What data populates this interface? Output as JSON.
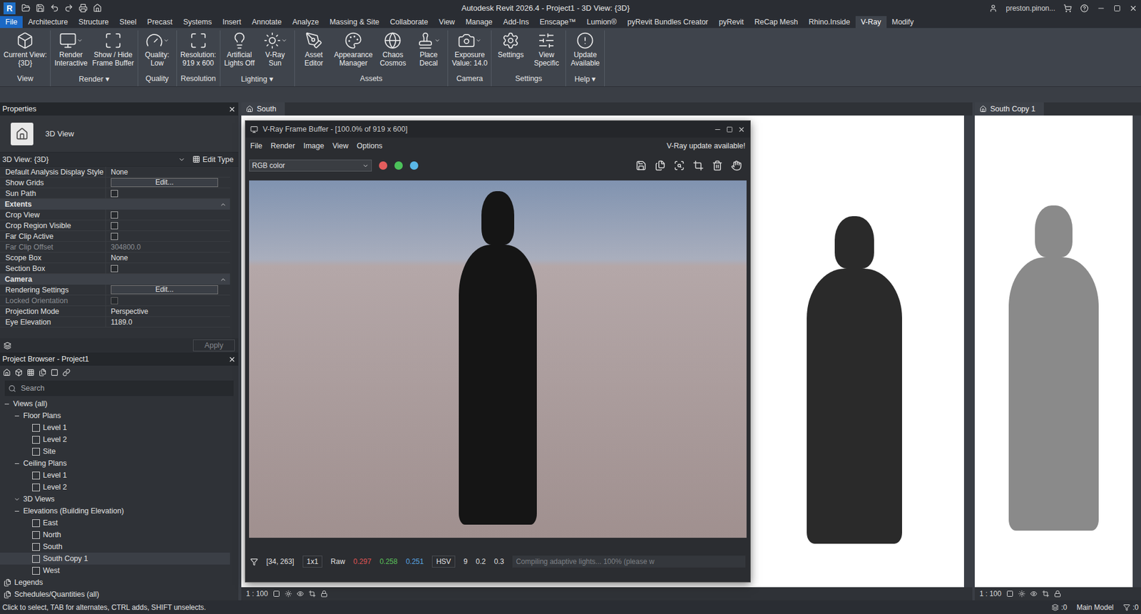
{
  "window": {
    "logo": "R",
    "title": "Autodesk Revit 2026.4 - Project1 - 3D View: {3D}",
    "user": "preston.pinon..."
  },
  "ribbon_tabs": [
    {
      "label": "File",
      "kind": "file",
      "selected": false
    },
    {
      "label": "Architecture",
      "kind": "tab",
      "selected": false
    },
    {
      "label": "Structure",
      "kind": "tab",
      "selected": false
    },
    {
      "label": "Steel",
      "kind": "tab",
      "selected": false
    },
    {
      "label": "Precast",
      "kind": "tab",
      "selected": false
    },
    {
      "label": "Systems",
      "kind": "tab",
      "selected": false
    },
    {
      "label": "Insert",
      "kind": "tab",
      "selected": false
    },
    {
      "label": "Annotate",
      "kind": "tab",
      "selected": false
    },
    {
      "label": "Analyze",
      "kind": "tab",
      "selected": false
    },
    {
      "label": "Massing & Site",
      "kind": "tab",
      "selected": false
    },
    {
      "label": "Collaborate",
      "kind": "tab",
      "selected": false
    },
    {
      "label": "View",
      "kind": "tab",
      "selected": false
    },
    {
      "label": "Manage",
      "kind": "tab",
      "selected": false
    },
    {
      "label": "Add-Ins",
      "kind": "tab",
      "selected": false
    },
    {
      "label": "Enscape™",
      "kind": "tab",
      "selected": false
    },
    {
      "label": "Lumion®",
      "kind": "tab",
      "selected": false
    },
    {
      "label": "pyRevit Bundles Creator",
      "kind": "tab",
      "selected": false
    },
    {
      "label": "pyRevit",
      "kind": "tab",
      "selected": false
    },
    {
      "label": "ReCap Mesh",
      "kind": "tab",
      "selected": false
    },
    {
      "label": "Rhino.Inside",
      "kind": "tab",
      "selected": false
    },
    {
      "label": "V-Ray",
      "kind": "tab",
      "selected": true
    },
    {
      "label": "Modify",
      "kind": "tab",
      "selected": false
    }
  ],
  "ribbon_groups": [
    {
      "label": "View",
      "buttons": [
        {
          "lines": [
            "Current View:",
            "{3D}"
          ],
          "dropdown": false
        }
      ]
    },
    {
      "label": "Render ▾",
      "buttons": [
        {
          "lines": [
            "Render",
            "Interactive"
          ],
          "dropdown": true
        },
        {
          "lines": [
            "Show / Hide",
            "Frame Buffer"
          ],
          "dropdown": false
        }
      ]
    },
    {
      "label": "Quality",
      "buttons": [
        {
          "lines": [
            "Quality:",
            "Low"
          ],
          "dropdown": true
        }
      ]
    },
    {
      "label": "Resolution",
      "buttons": [
        {
          "lines": [
            "Resolution:",
            "919 x 600"
          ],
          "dropdown": false
        }
      ]
    },
    {
      "label": "Lighting ▾",
      "buttons": [
        {
          "lines": [
            "Artificial",
            "Lights Off"
          ],
          "dropdown": false
        },
        {
          "lines": [
            "V-Ray",
            "Sun"
          ],
          "dropdown": true
        }
      ]
    },
    {
      "label": "Assets",
      "buttons": [
        {
          "lines": [
            "Asset",
            "Editor"
          ],
          "dropdown": false
        },
        {
          "lines": [
            "Appearance",
            "Manager"
          ],
          "dropdown": false
        },
        {
          "lines": [
            "Chaos",
            "Cosmos"
          ],
          "dropdown": false
        },
        {
          "lines": [
            "Place",
            "Decal"
          ],
          "dropdown": true
        }
      ]
    },
    {
      "label": "Camera",
      "buttons": [
        {
          "lines": [
            "Exposure",
            "Value: 14.0"
          ],
          "dropdown": true
        }
      ]
    },
    {
      "label": "Settings",
      "buttons": [
        {
          "lines": [
            "Settings"
          ],
          "dropdown": false
        },
        {
          "lines": [
            "View",
            "Specific"
          ],
          "dropdown": false
        }
      ]
    },
    {
      "label": "Help ▾",
      "buttons": [
        {
          "lines": [
            "Update",
            "Available"
          ],
          "dropdown": false
        }
      ]
    }
  ],
  "properties": {
    "title": "Properties",
    "type_name": "3D View",
    "instance": "3D View: {3D}",
    "edit_type": "Edit Type",
    "apply": "Apply",
    "apply_disabled": true,
    "rows": [
      {
        "kind": "text",
        "name": "Default Analysis Display Style",
        "value": "None",
        "disabled": false
      },
      {
        "kind": "button",
        "name": "Show Grids",
        "value": "Edit...",
        "disabled": false
      },
      {
        "kind": "check",
        "name": "Sun Path",
        "checked": false,
        "disabled": false
      },
      {
        "kind": "section",
        "name": "Extents",
        "expanded": true
      },
      {
        "kind": "check",
        "name": "Crop View",
        "checked": false,
        "disabled": false
      },
      {
        "kind": "check",
        "name": "Crop Region Visible",
        "checked": false,
        "disabled": false
      },
      {
        "kind": "check",
        "name": "Far Clip Active",
        "checked": false,
        "disabled": false
      },
      {
        "kind": "text",
        "name": "Far Clip Offset",
        "value": "304800.0",
        "disabled": true
      },
      {
        "kind": "text",
        "name": "Scope Box",
        "value": "None",
        "disabled": false
      },
      {
        "kind": "check",
        "name": "Section Box",
        "checked": false,
        "disabled": false
      },
      {
        "kind": "section",
        "name": "Camera",
        "expanded": true
      },
      {
        "kind": "button",
        "name": "Rendering Settings",
        "value": "Edit...",
        "disabled": false
      },
      {
        "kind": "check",
        "name": "Locked Orientation",
        "checked": false,
        "disabled": true
      },
      {
        "kind": "text",
        "name": "Projection Mode",
        "value": "Perspective",
        "disabled": false
      },
      {
        "kind": "text",
        "name": "Eye Elevation",
        "value": "1189.0",
        "disabled": false
      }
    ]
  },
  "project_browser": {
    "title": "Project Browser - Project1",
    "search_placeholder": "Search",
    "items": [
      {
        "label": "Views (all)",
        "depth": 0,
        "kind": "group",
        "expanded": true,
        "selected": false
      },
      {
        "label": "Floor Plans",
        "depth": 1,
        "kind": "group",
        "expanded": true,
        "selected": false
      },
      {
        "label": "Level 1",
        "depth": 2,
        "kind": "view",
        "expanded": false,
        "selected": false
      },
      {
        "label": "Level 2",
        "depth": 2,
        "kind": "view",
        "expanded": false,
        "selected": false
      },
      {
        "label": "Site",
        "depth": 2,
        "kind": "view",
        "expanded": false,
        "selected": false
      },
      {
        "label": "Ceiling Plans",
        "depth": 1,
        "kind": "group",
        "expanded": true,
        "selected": false
      },
      {
        "label": "Level 1",
        "depth": 2,
        "kind": "view",
        "expanded": false,
        "selected": false
      },
      {
        "label": "Level 2",
        "depth": 2,
        "kind": "view",
        "expanded": false,
        "selected": false
      },
      {
        "label": "3D Views",
        "depth": 1,
        "kind": "group",
        "expanded": false,
        "selected": false
      },
      {
        "label": "Elevations (Building Elevation)",
        "depth": 1,
        "kind": "group",
        "expanded": true,
        "selected": false
      },
      {
        "label": "East",
        "depth": 2,
        "kind": "view",
        "expanded": false,
        "selected": false
      },
      {
        "label": "North",
        "depth": 2,
        "kind": "view",
        "expanded": false,
        "selected": false
      },
      {
        "label": "South",
        "depth": 2,
        "kind": "view",
        "expanded": false,
        "selected": false
      },
      {
        "label": "South Copy 1",
        "depth": 2,
        "kind": "view",
        "expanded": false,
        "selected": true
      },
      {
        "label": "West",
        "depth": 2,
        "kind": "view",
        "expanded": false,
        "selected": false
      },
      {
        "label": "Legends",
        "depth": 0,
        "kind": "category",
        "expanded": false,
        "selected": false
      },
      {
        "label": "Schedules/Quantities (all)",
        "depth": 0,
        "kind": "category",
        "expanded": false,
        "selected": false
      }
    ]
  },
  "views": [
    {
      "tab": "South",
      "scale": "1 : 100",
      "figure_color": "#2a2a2a"
    },
    {
      "tab": "South Copy 1",
      "scale": "1 : 100",
      "figure_color": "#8a8a8a"
    }
  ],
  "frame_buffer": {
    "title": "V-Ray Frame Buffer - [100.0% of 919 x 600]",
    "menu": [
      "File",
      "Render",
      "Image",
      "View",
      "Options"
    ],
    "notice": "V-Ray update available!",
    "channel": "RGB color",
    "swatches": [
      {
        "color": "#e35d5d"
      },
      {
        "color": "#4cc25a"
      },
      {
        "color": "#5ab8e8"
      }
    ],
    "status": {
      "coords": "[34, 263]",
      "zoom": "1x1",
      "mode": "Raw",
      "readings": [
        {
          "value": "0.297",
          "color": "#e05555"
        },
        {
          "value": "0.258",
          "color": "#5bc25b"
        },
        {
          "value": "0.251",
          "color": "#5aa8e6"
        }
      ],
      "space": "HSV",
      "values": [
        "9",
        "0.2",
        "0.3"
      ],
      "progress": "Compiling adaptive lights... 100% (please w"
    }
  },
  "status_bar": {
    "hint": "Click to select, TAB for alternates, CTRL adds, SHIFT unselects.",
    "worksets": ":0",
    "model": "Main Model",
    "filter": ":0"
  }
}
